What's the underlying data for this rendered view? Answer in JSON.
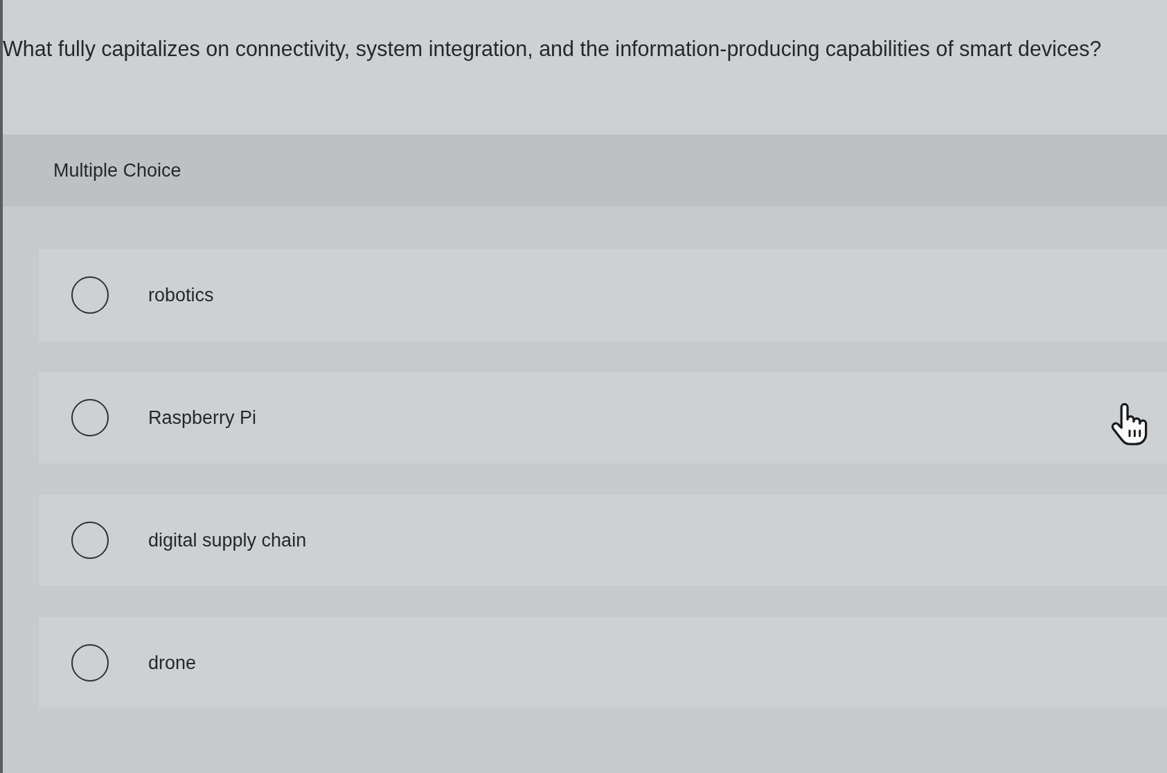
{
  "question": {
    "text": "What fully capitalizes on connectivity, system integration, and the information-producing capabilities of smart devices?"
  },
  "section": {
    "label": "Multiple Choice"
  },
  "options": [
    {
      "label": "robotics",
      "selected": false
    },
    {
      "label": "Raspberry Pi",
      "selected": false
    },
    {
      "label": "digital supply chain",
      "selected": false
    },
    {
      "label": "drone",
      "selected": false
    }
  ]
}
